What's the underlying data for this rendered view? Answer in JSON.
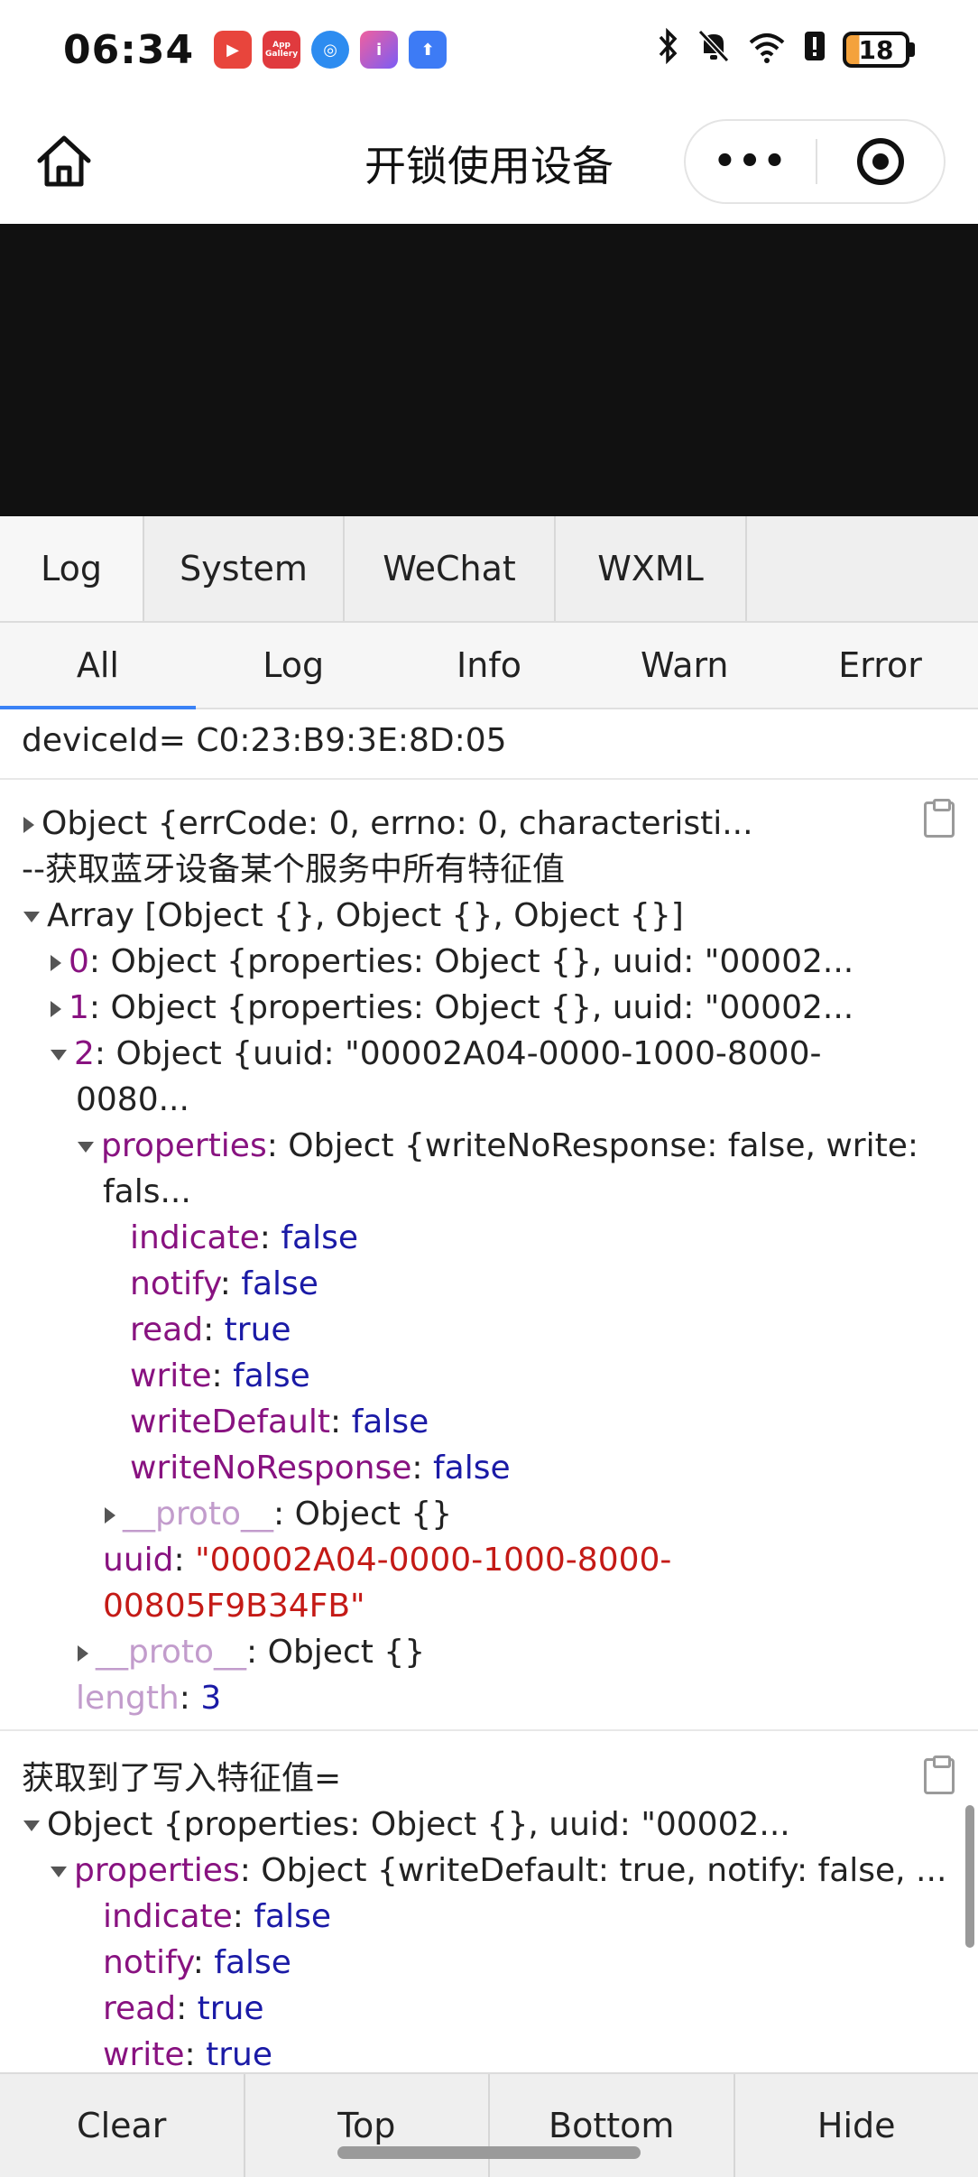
{
  "status_bar": {
    "time": "06:34",
    "battery_level": "18",
    "apps": [
      {
        "icon": "video-app-icon",
        "color": "#e8453c"
      },
      {
        "icon": "app-gallery-icon",
        "color": "#e03a3e",
        "label": "App Gallery"
      },
      {
        "icon": "browser-icon",
        "color": "#2d8cf0"
      },
      {
        "icon": "i-app-icon",
        "color": "#7b5cf5"
      },
      {
        "icon": "upload-app-icon",
        "color": "#3d7bf5"
      }
    ]
  },
  "navbar": {
    "title": "开锁使用设备",
    "more": "•••"
  },
  "tabs_top": [
    {
      "label": "Log",
      "active": true
    },
    {
      "label": "System",
      "active": false
    },
    {
      "label": "WeChat",
      "active": false
    },
    {
      "label": "WXML",
      "active": false
    }
  ],
  "tabs_filter": [
    {
      "label": "All",
      "active": true
    },
    {
      "label": "Log",
      "active": false
    },
    {
      "label": "Info",
      "active": false
    },
    {
      "label": "Warn",
      "active": false
    },
    {
      "label": "Error",
      "active": false
    }
  ],
  "log": {
    "e1": {
      "text": "deviceId= C0:23:B9:3E:8D:05"
    },
    "e2": {
      "l1": "Object {errCode: 0, errno: 0, characteristi...",
      "l2": "--获取蓝牙设备某个服务中所有特征值",
      "l3": "Array [Object {}, Object {}, Object {}]",
      "l4_idx": "0",
      "l4": ": Object {properties: Object {}, uuid: \"00002...",
      "l5_idx": "1",
      "l5": ": Object {properties: Object {}, uuid: \"00002...",
      "l6_idx": "2",
      "l6": ": Object {uuid: \"00002A04-0000-1000-8000-",
      "l7": "0080...",
      "l8_key": "properties",
      "l8": ": Object {writeNoResponse: false, write:",
      "l9": "fals...",
      "props": [
        {
          "key": "indicate",
          "value": "false"
        },
        {
          "key": "notify",
          "value": "false"
        },
        {
          "key": "read",
          "value": "true"
        },
        {
          "key": "write",
          "value": "false"
        },
        {
          "key": "writeDefault",
          "value": "false"
        },
        {
          "key": "writeNoResponse",
          "value": "false"
        }
      ],
      "proto_key": "__proto__",
      "proto_val": ": Object {}",
      "uuid_key": "uuid",
      "uuid_val1": "\"00002A04-0000-1000-8000-",
      "uuid_val2": "00805F9B34FB\"",
      "proto2_key": "__proto__",
      "proto2_val": ": Object {}",
      "length_key": "length",
      "length_val": "3"
    },
    "e3": {
      "l1": "获取到了写入特征值=",
      "l2": "Object {properties: Object {}, uuid: \"00002...",
      "l3_key": "properties",
      "l3": ": Object {writeDefault: true, notify: false, ...",
      "props": [
        {
          "key": "indicate",
          "value": "false"
        },
        {
          "key": "notify",
          "value": "false"
        },
        {
          "key": "read",
          "value": "true"
        },
        {
          "key": "write",
          "value": "true"
        }
      ]
    }
  },
  "toolbar": [
    {
      "label": "Clear"
    },
    {
      "label": "Top"
    },
    {
      "label": "Bottom"
    },
    {
      "label": "Hide"
    }
  ]
}
